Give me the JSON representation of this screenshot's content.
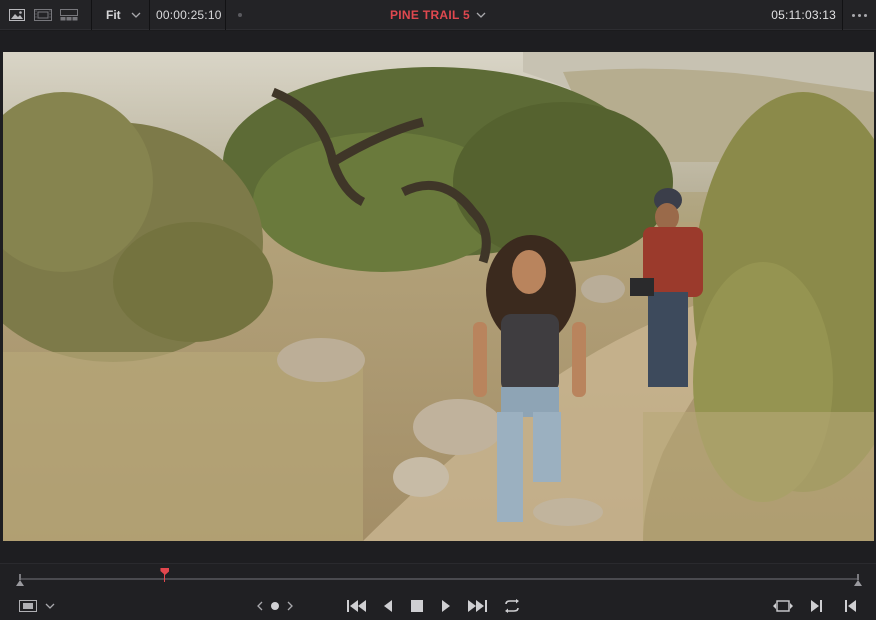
{
  "toolbar": {
    "zoom_label": "Fit",
    "source_timecode": "00:00:25:10",
    "clip_title": "PINE TRAIL 5",
    "record_timecode": "05:11:03:13"
  },
  "icons": {
    "view_single": "image-viewer-icon",
    "view_filmstrip": "filmstrip-viewer-icon",
    "view_multi": "multi-viewer-icon",
    "more": "more-options-icon"
  },
  "colors": {
    "accent_red": "#e0484f",
    "background": "#1b1b1d",
    "toolbar": "#232326"
  },
  "transport": {
    "playhead_position": 0.173,
    "buttons": [
      "jump-to-start",
      "step-back",
      "stop",
      "play",
      "jump-to-end",
      "loop"
    ]
  }
}
